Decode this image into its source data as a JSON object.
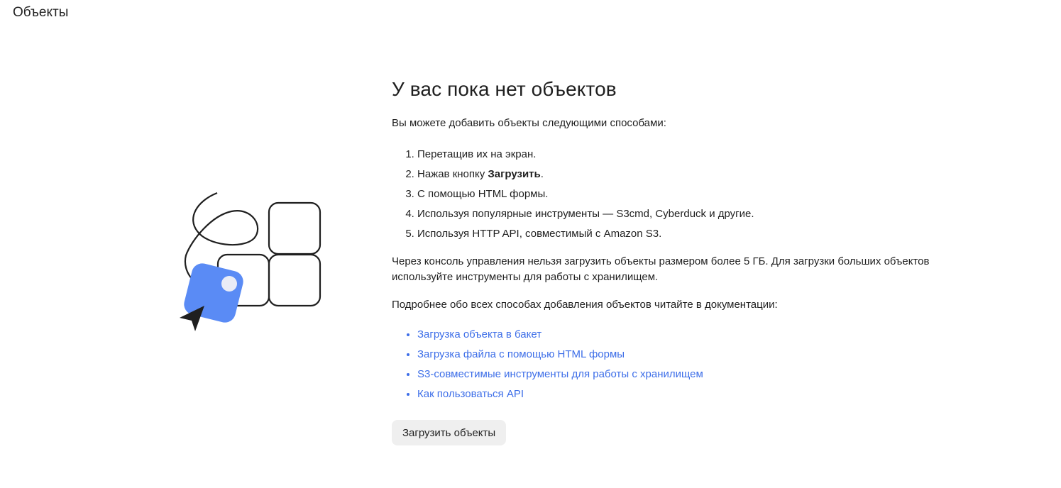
{
  "header": {
    "title": "Объекты"
  },
  "illustration": {
    "icon": "upload-objects-illustration",
    "accent_color": "#5a8bf5",
    "dot_color": "#e9ecf6"
  },
  "empty_state": {
    "heading": "У вас пока нет объектов",
    "intro": "Вы можете добавить объекты следующими способами:",
    "methods": [
      {
        "text": "Перетащив их на экран."
      },
      {
        "before": "Нажав кнопку ",
        "bold": "Загрузить",
        "after": "."
      },
      {
        "text": "С помощью HTML формы."
      },
      {
        "text": "Используя популярные инструменты — S3cmd, Cyberduck и другие."
      },
      {
        "text": "Используя HTTP API, совместимый с Amazon S3."
      }
    ],
    "warning": "Через консоль управления нельзя загрузить объекты размером более 5 ГБ. Для загрузки больших объектов используйте инструменты для работы с хранилищем.",
    "docs_intro": "Подробнее обо всех способах добавления объектов читайте в документации:",
    "links": [
      {
        "label": "Загрузка объекта в бакет"
      },
      {
        "label": "Загрузка файла с помощью HTML формы"
      },
      {
        "label": "S3-совместимые инструменты для работы с хранилищем"
      },
      {
        "label": "Как пользоваться API"
      }
    ],
    "upload_button": "Загрузить объекты"
  },
  "colors": {
    "link": "#3d6ee8",
    "button_bg": "#efefef",
    "text": "#1f1f1f"
  }
}
